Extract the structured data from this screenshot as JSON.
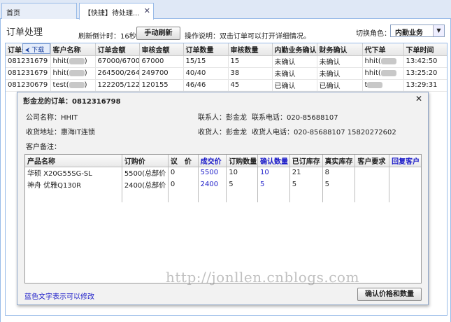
{
  "tabs": [
    {
      "label": "首页"
    },
    {
      "label": "【快捷】待处理..."
    }
  ],
  "panel": {
    "title": "订单处理",
    "refresh_label": "刷新倒计时：16秒",
    "refresh_button": "手动刷新",
    "help_text": "操作说明：双击订单可以打开详细情况。",
    "role_label": "切换角色：",
    "role_value": "内勤业务"
  },
  "grid": {
    "columns": [
      "订单号",
      "客户名称",
      "订单金额",
      "审核金额",
      "订单数量",
      "审核数量",
      "内勤业务确认",
      "财务确认",
      "代下单",
      "下单时间"
    ],
    "rows": [
      [
        "081231679",
        "hhit(",
        "67000/6700",
        "67000",
        "15/15",
        "15",
        "未确认",
        "未确认",
        "hhit(",
        "13:42:50"
      ],
      [
        "081231679",
        "hhit(",
        "264500/264",
        "249700",
        "40/40",
        "38",
        "未确认",
        "未确认",
        "hhit(",
        "13:25:20"
      ],
      [
        "081230679",
        "test(",
        "122205/122",
        "120155",
        "46/46",
        "45",
        "已确认",
        "已确认",
        "t",
        "13:29:31"
      ]
    ],
    "download_badge": "下载"
  },
  "modal": {
    "title": "彭金龙的订单：0812316798",
    "company": "公司名称：HHIT",
    "contact": "联系人：彭金龙",
    "phone": "联系电话：020-85688107",
    "address": "收货地址：惠海IT连锁",
    "receiver": "收货人：彭金龙",
    "receiver_phone": "收货人电话：020-85688107 15820272602",
    "remark": "客户备注：",
    "columns": [
      "产品名称",
      "订购价",
      "议　价",
      "成交价",
      "订购数量",
      "确认数量",
      "已订库存",
      "真实库存",
      "客户要求",
      "回复客户"
    ],
    "rows": [
      [
        "华硕 X20G55SG-SL",
        "5500(总部价",
        "0",
        "5500",
        "10",
        "10",
        "21",
        "8",
        "",
        ""
      ],
      [
        "神舟 优雅Q130R",
        "2400(总部价",
        "0",
        "2400",
        "5",
        "5",
        "5",
        "5",
        "",
        ""
      ]
    ],
    "note": "蓝色文字表示可以修改",
    "confirm_button": "确认价格和数量",
    "close_symbol": "✕"
  },
  "watermark": "http://jonllen.cnblogs.com"
}
